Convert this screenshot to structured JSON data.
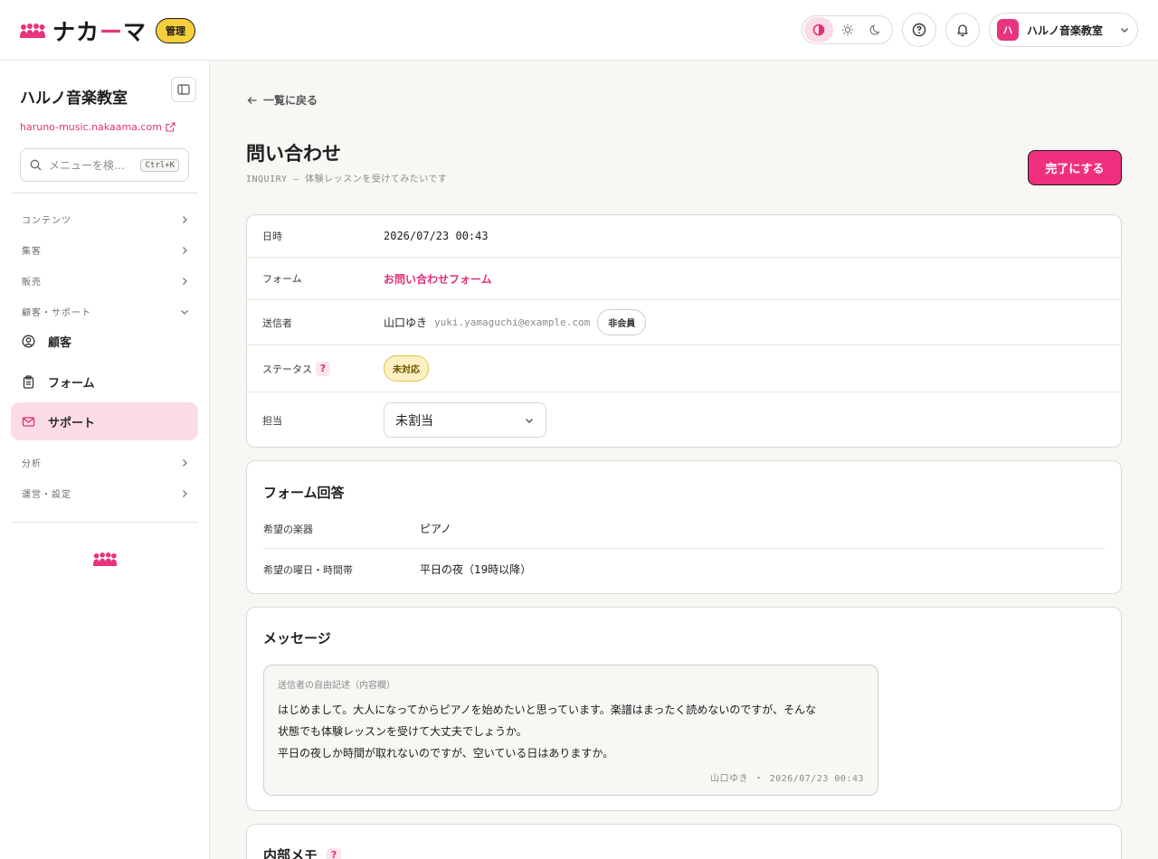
{
  "header": {
    "brand_name": "ナカーマ",
    "brand_main": "ナカ",
    "brand_dash": "ー",
    "brand_tail": "マ",
    "admin_badge": "管理",
    "account_initial": "ハ",
    "account_name": "ハルノ音楽教室"
  },
  "sidebar": {
    "workspace_title": "ハルノ音楽教室",
    "workspace_url": "haruno-music.nakaama.com",
    "search_placeholder": "メニューを検…",
    "search_shortcut": "Ctrl+K",
    "groups": [
      {
        "label": "コンテンツ"
      },
      {
        "label": "集客"
      },
      {
        "label": "販売"
      },
      {
        "label": "顧客・サポート"
      },
      {
        "label": "分析"
      },
      {
        "label": "運営・設定"
      }
    ],
    "items": [
      {
        "label": "顧客",
        "icon": "user-circle-icon"
      },
      {
        "label": "フォーム",
        "icon": "clipboard-icon"
      },
      {
        "label": "サポート",
        "icon": "mail-icon",
        "active": true
      }
    ]
  },
  "main": {
    "back_label": "一覧に戻る",
    "title": "問い合わせ",
    "subtitle": "INQUIRY — 体験レッスンを受けてみたいです",
    "done_button": "完了にする",
    "details": {
      "datetime_label": "日時",
      "datetime_value": "2026/07/23 00:43",
      "form_label": "フォーム",
      "form_value": "お問い合わせフォーム",
      "sender_label": "送信者",
      "sender_name": "山口ゆき",
      "sender_email": "yuki.yamaguchi@example.com",
      "sender_badge": "非会員",
      "status_label": "ステータス",
      "status_help": "?",
      "status_value": "未対応",
      "assignee_label": "担当",
      "assignee_value": "未割当"
    },
    "form_answers": {
      "title": "フォーム回答",
      "rows": [
        {
          "label": "希望の楽器",
          "value": "ピアノ"
        },
        {
          "label": "希望の曜日・時間帯",
          "value": "平日の夜（19時以降）"
        }
      ]
    },
    "message": {
      "title": "メッセージ",
      "caption": "送信者の自由記述（内容欄）",
      "lines": [
        "はじめまして。大人になってからピアノを始めたいと思っています。楽譜はまったく読めないのですが、そんな",
        "状態でも体験レッスンを受けて大丈夫でしょうか。",
        "平日の夜しか時間が取れないのですが、空いている日はありますか。"
      ],
      "meta": "山口ゆき ・ 2026/07/23 00:43"
    },
    "internal_memo": {
      "title": "内部メモ",
      "help": "?"
    }
  },
  "colors": {
    "accent": "#f0307e",
    "active_bg": "#fcdbe8",
    "badge_yellow": "#f6cf3d",
    "page_bg": "#f8f7f4"
  }
}
